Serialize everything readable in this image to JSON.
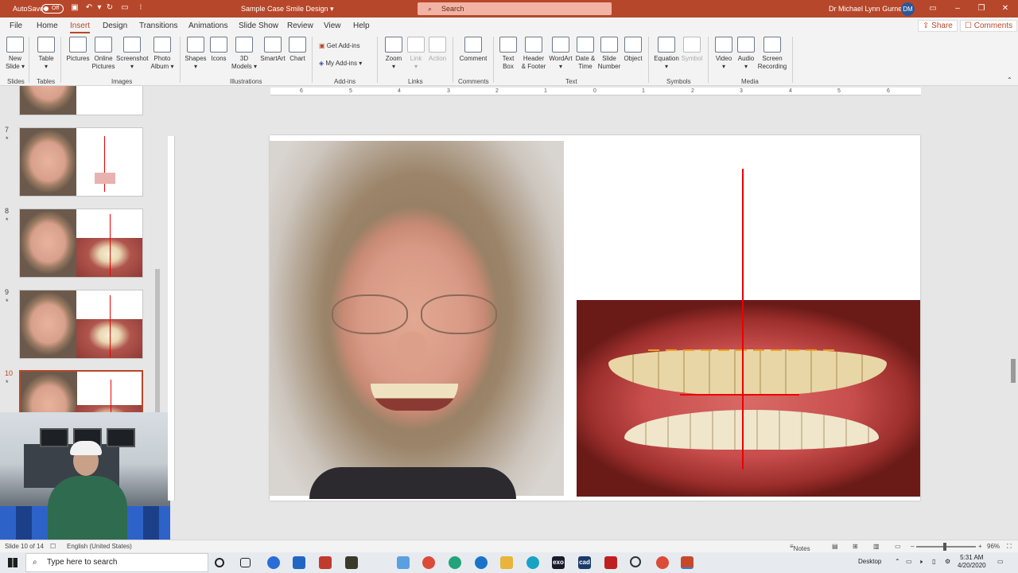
{
  "titlebar": {
    "autosave_label": "AutoSave",
    "autosave_state": "Off",
    "document_title": "Sample Case Smile Design",
    "search_placeholder": "Search",
    "user_name": "Dr Michael Lynn Gurney",
    "user_initials": "DM"
  },
  "menu_tabs": [
    "File",
    "Home",
    "Insert",
    "Design",
    "Transitions",
    "Animations",
    "Slide Show",
    "Review",
    "View",
    "Help"
  ],
  "active_tab": "Insert",
  "share_label": "Share",
  "comments_label": "Comments",
  "ribbon": {
    "new_slide": [
      "New",
      "Slide"
    ],
    "table": "Table",
    "pictures": "Pictures",
    "online_pictures": [
      "Online",
      "Pictures"
    ],
    "screenshot": "Screenshot",
    "photo_album": [
      "Photo",
      "Album"
    ],
    "shapes": "Shapes",
    "icons": "Icons",
    "models_3d": [
      "3D",
      "Models"
    ],
    "smartart": "SmartArt",
    "chart": "Chart",
    "get_addins": "Get Add-ins",
    "my_addins": "My Add-ins",
    "zoom": "Zoom",
    "link": "Link",
    "action": "Action",
    "comment": "Comment",
    "text_box": [
      "Text",
      "Box"
    ],
    "header_footer": [
      "Header",
      "& Footer"
    ],
    "wordart": "WordArt",
    "date_time": [
      "Date &",
      "Time"
    ],
    "slide_number": [
      "Slide",
      "Number"
    ],
    "object": "Object",
    "equation": "Equation",
    "symbol": "Symbol",
    "video": "Video",
    "audio": "Audio",
    "screen_recording": [
      "Screen",
      "Recording"
    ],
    "groups": {
      "slides": "Slides",
      "tables": "Tables",
      "images": "Images",
      "illustrations": "Illustrations",
      "addins": "Add-ins",
      "links": "Links",
      "comments": "Comments",
      "text": "Text",
      "symbols": "Symbols",
      "media": "Media"
    }
  },
  "thumbnails": [
    {
      "number": "7",
      "star": "*"
    },
    {
      "number": "8",
      "star": "*"
    },
    {
      "number": "9",
      "star": "*"
    },
    {
      "number": "10",
      "star": "*"
    }
  ],
  "ruler_labels": [
    "6",
    "5",
    "4",
    "3",
    "2",
    "1",
    "0",
    "1",
    "2",
    "3",
    "4",
    "5",
    "6"
  ],
  "statusbar": {
    "slide_info": "Slide 10 of 14",
    "language": "English (United States)",
    "notes_label": "Notes",
    "zoom_level": "96%"
  },
  "taskbar": {
    "search_placeholder": "Type here to search",
    "desktop_label": "Desktop",
    "time": "5:31 AM",
    "date": "4/20/2020",
    "app_labels": {
      "exo": "exo",
      "cad": "cad"
    }
  },
  "colors": {
    "accent": "#b7472a",
    "midline": "#ee0000"
  }
}
